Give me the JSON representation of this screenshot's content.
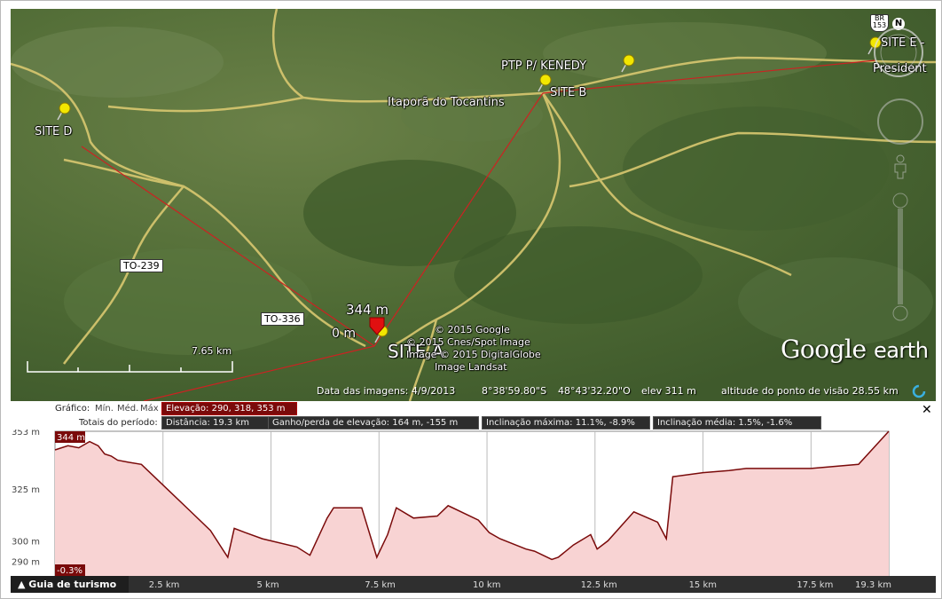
{
  "map": {
    "places": {
      "site_d": "SITE D",
      "site_b": "SITE B",
      "ptp": "PTP P/ KENEDY",
      "itapora": "Itaporã do Tocantins",
      "site_e": "SITE E -",
      "president": "President",
      "site_a": "SITE A",
      "alt_344": "344 m",
      "alt_0": "0 m"
    },
    "roads": {
      "to239": "TO-239",
      "to336": "TO-336",
      "br153": "BR 153"
    },
    "scale_label": "7.65 km",
    "compass_label": "N",
    "copyright": [
      "© 2015 Google",
      "© 2015 Cnes/Spot Image",
      "Image © 2015 DigitalGlobe",
      "Image Landsat"
    ],
    "logo_google": "Google",
    "logo_earth": "earth",
    "status": {
      "imagery_date": "Data das imagens: 4/9/2013",
      "lat": "8°38'59.80\"S",
      "lon": "48°43'32.20\"O",
      "elev": "elev   311 m",
      "eye_alt": "altitude do ponto de visão  28.55 km"
    },
    "colors": {
      "path": "#cc2222",
      "road": "#d9c870",
      "pin": "#f2e600"
    }
  },
  "profile": {
    "header": {
      "graph_label": "Gráfico:",
      "min": "Mín.",
      "med": "Méd.",
      "max": "Máx",
      "elevation": "Elevação: 290, 318, 353 m",
      "totals_label": "Totais do período:",
      "distance": "Distância: 19.3 km",
      "gain_loss": "Ganho/perda de elevação: 164 m, -155 m",
      "max_slope": "Inclinação máxima: 11.1%, -8.9%",
      "avg_slope": "Inclinação média: 1.5%, -1.6%",
      "close": "✕"
    },
    "cursor_value": "344 m",
    "slope_value": "-0.3%",
    "tour_button": "Guia de turismo",
    "colors": {
      "line": "#7a0a0a",
      "fill": "#f7d6d6"
    }
  },
  "chart_data": {
    "type": "area",
    "title": "",
    "xlabel": "",
    "ylabel": "",
    "x_unit": "km",
    "y_unit": "m",
    "xlim": [
      0,
      19.3
    ],
    "ylim": [
      283,
      353
    ],
    "y_ticks": [
      {
        "value": 353,
        "label": "353 m"
      },
      {
        "value": 325,
        "label": "325 m"
      },
      {
        "value": 300,
        "label": "300 m"
      },
      {
        "value": 290,
        "label": "290 m"
      }
    ],
    "x_ticks": [
      {
        "value": 2.5,
        "label": "2.5 km"
      },
      {
        "value": 5,
        "label": "5 km"
      },
      {
        "value": 7.5,
        "label": "7.5 km"
      },
      {
        "value": 10,
        "label": "10 km"
      },
      {
        "value": 12.5,
        "label": "12.5 km"
      },
      {
        "value": 15,
        "label": "15 km"
      },
      {
        "value": 17.5,
        "label": "17.5 km"
      },
      {
        "value": 19.3,
        "label": "19.3 km"
      }
    ],
    "grid": true,
    "series": [
      {
        "x": [
          0,
          0.3,
          0.55,
          0.8,
          1.0,
          1.15,
          1.3,
          1.45,
          1.7,
          2.0,
          2.6,
          3.1,
          3.6,
          4.0,
          4.15,
          4.4,
          4.8,
          5.6,
          5.9,
          6.3,
          6.45,
          7.1,
          7.45,
          7.7,
          7.9,
          8.3,
          8.85,
          9.1,
          9.8,
          10.05,
          10.3,
          10.9,
          11.1,
          11.5,
          11.65,
          12.0,
          12.4,
          12.55,
          12.8,
          13.4,
          13.95,
          14.1,
          14.15,
          14.3,
          15.0,
          15.6,
          16.0,
          17.5,
          18.6,
          19.3
        ],
        "y": [
          344,
          346,
          345,
          348,
          346,
          342,
          341,
          339,
          338,
          337,
          325,
          315,
          305,
          292,
          306,
          304,
          301,
          297,
          293,
          311,
          316,
          316,
          292,
          303,
          316,
          311,
          312,
          317,
          310,
          304,
          301,
          296,
          295,
          291,
          292,
          298,
          303,
          296,
          300,
          314,
          309,
          303,
          301,
          331,
          333,
          334,
          335,
          335,
          337,
          353
        ]
      }
    ]
  }
}
